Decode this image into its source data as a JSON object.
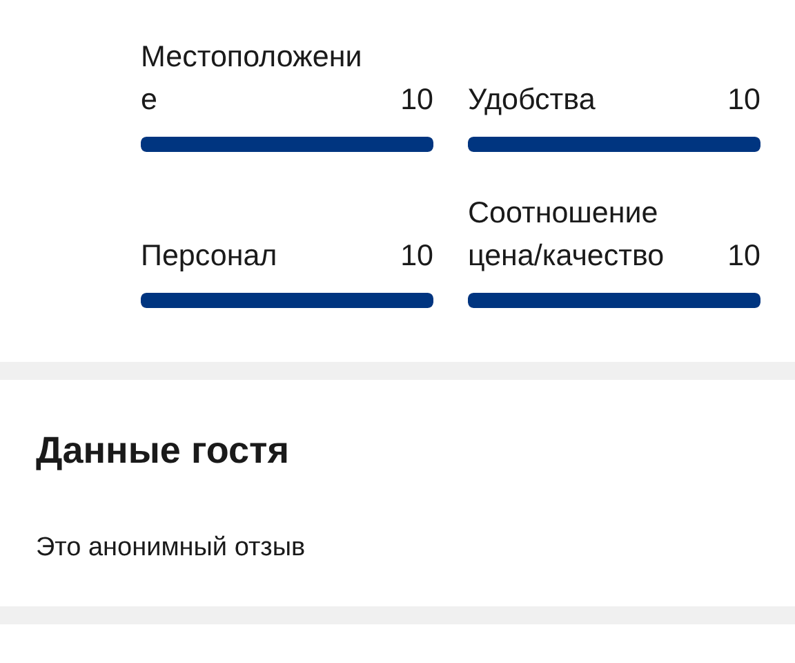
{
  "ratings": [
    {
      "label": "Местоположение",
      "score": "10",
      "level": 1
    },
    {
      "label": "Удобства",
      "score": "10",
      "level": 1
    },
    {
      "label": "Персонал",
      "score": "10",
      "level": 1
    },
    {
      "label": "Соотношение цена/качество",
      "score": "10",
      "level": 1
    }
  ],
  "guest": {
    "title": "Данные гостя",
    "text": "Это анонимный отзыв"
  }
}
